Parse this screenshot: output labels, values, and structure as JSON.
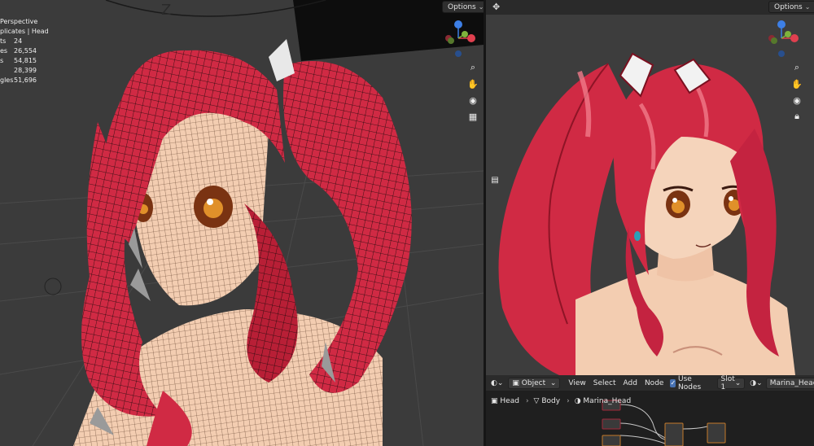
{
  "left_viewport": {
    "options_label": "Options",
    "mode_line": "Perspective",
    "collection_line": "plicates | Head",
    "axis_z_label": "Z",
    "stats": [
      {
        "key": "ts",
        "value": "24"
      },
      {
        "key": "es",
        "value": "26,554"
      },
      {
        "key": "s",
        "value": "54,815"
      },
      {
        "key": "",
        "value": "28,399"
      },
      {
        "key": "gles",
        "value": "51,696"
      }
    ]
  },
  "right_viewport": {
    "options_label": "Options",
    "gizmo_z": "Z",
    "gizmo_y": "Y",
    "gizmo_x": "X"
  },
  "node_editor": {
    "object_type": "Object",
    "menu": [
      "View",
      "Select",
      "Add",
      "Node"
    ],
    "use_nodes_label": "Use Nodes",
    "use_nodes_checked": true,
    "slot": "Slot 1",
    "material": "Marina_Head",
    "breadcrumb": [
      "Head",
      "Body",
      "Marina_Head"
    ]
  },
  "colors": {
    "hair": "#d02a44",
    "hair_dark": "#8e1426",
    "skin": "#f3cdb1",
    "background": "#3b3b3b",
    "gizmo_x": "#e0404f",
    "gizmo_y": "#7fb33c",
    "gizmo_z": "#3d7fe6"
  }
}
